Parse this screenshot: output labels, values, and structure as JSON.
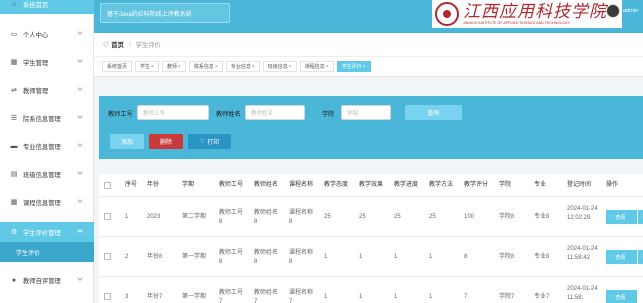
{
  "sidebar": {
    "items": [
      {
        "label": "系统首页",
        "icon": "home-icon"
      },
      {
        "label": "个人中心",
        "icon": "user-card-icon"
      },
      {
        "label": "学生管理",
        "icon": "grid-icon"
      },
      {
        "label": "教师管理",
        "icon": "sliders-icon"
      },
      {
        "label": "院系信息管理",
        "icon": "list-icon"
      },
      {
        "label": "专业信息管理",
        "icon": "car-icon"
      },
      {
        "label": "班级信息管理",
        "icon": "inbox-icon"
      },
      {
        "label": "课程信息管理",
        "icon": "grid-icon"
      },
      {
        "label": "学生评价管理",
        "icon": "gear-icon"
      },
      {
        "label": "教师自评管理",
        "icon": "user-icon"
      }
    ],
    "sub_items": [
      "学生评价"
    ]
  },
  "header": {
    "system_title": "基于Java的应科院线上评教系统",
    "logo_cn": "江西应用科技学院",
    "logo_en": "JIANGXI INSTITUTE OF APPLIED SCIENCE AND TECHNOLOGY",
    "username": "admin"
  },
  "breadcrumb": {
    "home": "首页",
    "current": "学生评价"
  },
  "tags": [
    "系统首页",
    "学生",
    "教师",
    "院系信息",
    "专业信息",
    "班级信息",
    "课程信息",
    "学生评价"
  ],
  "search": {
    "teacher_no_label": "教师工号",
    "teacher_no_placeholder": "教师工号",
    "teacher_name_label": "教师姓名",
    "teacher_name_placeholder": "教师姓名",
    "college_label": "学院",
    "college_placeholder": "学院",
    "query_button": "查询",
    "add_button": "添加",
    "delete_button": "删除",
    "print_button": "打印"
  },
  "table": {
    "columns": [
      "序号",
      "年份",
      "学期",
      "教师工号",
      "教师姓名",
      "课程名称",
      "教学态度",
      "教学效果",
      "教学进度",
      "教学方法",
      "教学评分",
      "学院",
      "专业",
      "登记时间",
      "操作"
    ],
    "rows": [
      {
        "no": "1",
        "year": "2023",
        "term": "第二学期",
        "tno": "教师工号8",
        "tname": "教师姓名8",
        "course": "课程名称8",
        "attitude": "25",
        "effect": "25",
        "progress": "25",
        "method": "25",
        "score": "100",
        "college": "学院8",
        "major": "专业8",
        "time": "2024-01-24 12:02:29",
        "view": "查看"
      },
      {
        "no": "2",
        "year": "年份8",
        "term": "第一学期",
        "tno": "教师工号8",
        "tname": "教师姓名8",
        "course": "课程名称8",
        "attitude": "1",
        "effect": "1",
        "progress": "1",
        "method": "1",
        "score": "8",
        "college": "学院8",
        "major": "专业8",
        "time": "2024-01-24 11:58:42",
        "view": "查看"
      },
      {
        "no": "3",
        "year": "年份7",
        "term": "第一学期",
        "tno": "教师工号7",
        "tname": "教师姓名7",
        "course": "课程名称7",
        "attitude": "1",
        "effect": "1",
        "progress": "1",
        "method": "1",
        "score": "7",
        "college": "学院7",
        "major": "专业7",
        "time": "2024-01-24 11:58:",
        "view": "查看"
      }
    ]
  },
  "colors": {
    "primary": "#4ab7d8",
    "accent": "#5fc9e6",
    "danger": "#c93a3a",
    "logo": "#b0282d"
  }
}
